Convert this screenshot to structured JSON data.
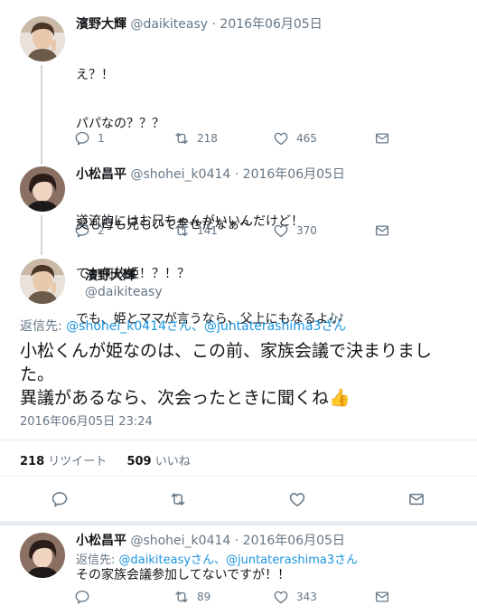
{
  "tweets": [
    {
      "name": "濱野大輝",
      "handle": "@daikiteasy",
      "date": "· 2016年06月05日",
      "lines": [
        "え？！",
        "パパなの？？？",
        "",
        "道流的にはお兄ちゃんがいいんだけど！",
        "",
        "でも、姫とママが言うなら、父上にもなるよ🎶"
      ],
      "replies": "1",
      "retweets": "218",
      "likes": "465"
    },
    {
      "name": "小松昌平",
      "handle": "@shohei_k0414",
      "date": "· 2016年06月05日",
      "lines": [
        "父も母も兄もいて幸せだなぁ〜",
        "てか何故姫！？！？"
      ],
      "replies": "2",
      "retweets": "141",
      "likes": "370"
    }
  ],
  "focus": {
    "name": "濱野大輝",
    "handle": "@daikiteasy",
    "reply_prefix": "返信先: ",
    "reply_mention1": "@shohei_k0414さん",
    "reply_and": "、",
    "reply_mention2": "@juntaterashima3さん",
    "line1": "小松くんが姫なのは、この前、家族会議で決まりまし",
    "line2": "た。",
    "line3": "異議があるなら、次会ったときに聞くね👍",
    "timestamp": "2016年06月05日 23:24",
    "retweet_count": "218",
    "retweet_label": "リツイート",
    "like_count": "509",
    "like_label": "いいね"
  },
  "reply": {
    "name": "小松昌平",
    "handle": "@shohei_k0414",
    "date": "· 2016年06月05日",
    "reply_prefix": "返信先: ",
    "reply_mention1": "@daikiteasyさん",
    "reply_and": "、",
    "reply_mention2": "@juntaterashima3さん",
    "text": "その家族会議参加してないですが！！",
    "retweets": "89",
    "likes": "343"
  },
  "icons": {
    "reply": "reply-icon",
    "retweet": "retweet-icon",
    "like": "heart-icon",
    "dm": "envelope-icon"
  },
  "colors": {
    "link": "#1b95e0",
    "meta": "#657786",
    "text": "#14171a",
    "divider": "#e6ecf0"
  }
}
